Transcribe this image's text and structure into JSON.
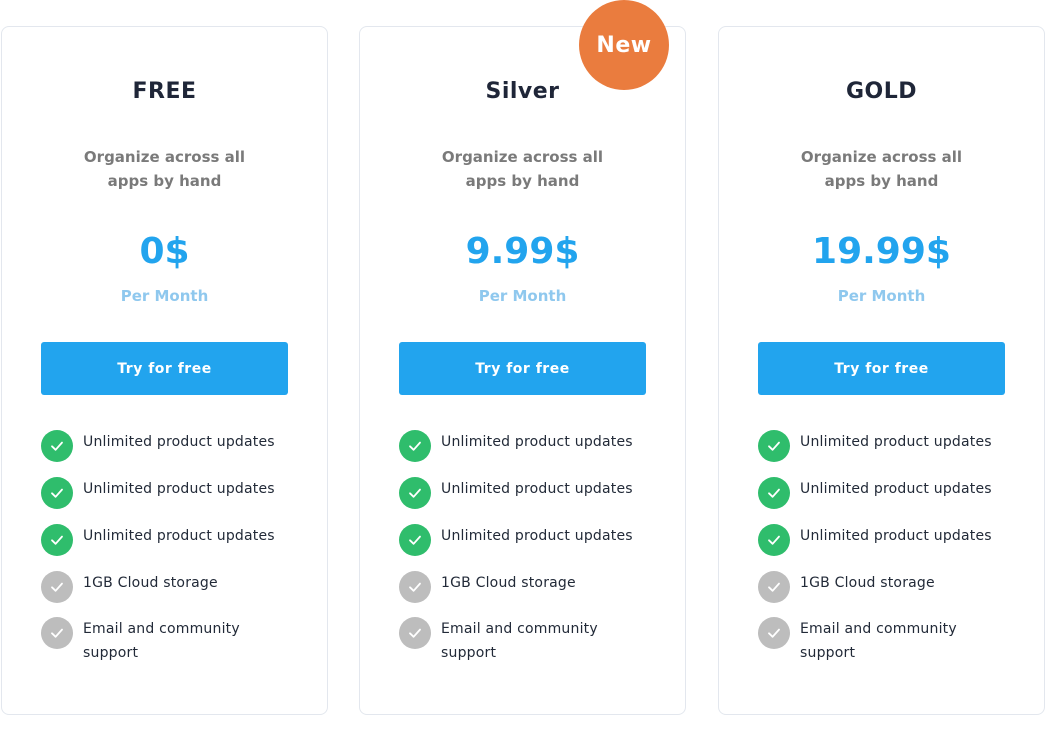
{
  "badge": {
    "label": "New",
    "color": "#ea7c3e"
  },
  "colors": {
    "accent": "#22a4ee",
    "check_on": "#2fbd6c",
    "check_off": "#bdbdbd"
  },
  "plans": [
    {
      "name": "FREE",
      "description": "Organize across all apps by hand",
      "price": "0$",
      "period": "Per Month",
      "cta": "Try for free",
      "features": [
        {
          "text": "Unlimited product updates",
          "included": true,
          "icon": "check-icon"
        },
        {
          "text": "Unlimited product updates",
          "included": true,
          "icon": "check-icon"
        },
        {
          "text": "Unlimited product updates",
          "included": true,
          "icon": "check-icon"
        },
        {
          "text": "1GB  Cloud storage",
          "included": false,
          "icon": "check-icon"
        },
        {
          "text": "Email and community support",
          "included": false,
          "icon": "check-icon"
        }
      ]
    },
    {
      "name": "Silver",
      "description": "Organize across all apps by hand",
      "price": "9.99$",
      "period": "Per Month",
      "cta": "Try for free",
      "features": [
        {
          "text": "Unlimited product updates",
          "included": true,
          "icon": "check-icon"
        },
        {
          "text": "Unlimited product updates",
          "included": true,
          "icon": "check-icon"
        },
        {
          "text": "Unlimited product updates",
          "included": true,
          "icon": "check-icon"
        },
        {
          "text": "1GB  Cloud storage",
          "included": false,
          "icon": "check-icon"
        },
        {
          "text": "Email and community support",
          "included": false,
          "icon": "check-icon"
        }
      ]
    },
    {
      "name": "GOLD",
      "description": "Organize across all apps by hand",
      "price": "19.99$",
      "period": "Per Month",
      "cta": "Try for free",
      "features": [
        {
          "text": "Unlimited product updates",
          "included": true,
          "icon": "check-icon"
        },
        {
          "text": "Unlimited product updates",
          "included": true,
          "icon": "check-icon"
        },
        {
          "text": "Unlimited product updates",
          "included": true,
          "icon": "check-icon"
        },
        {
          "text": "1GB  Cloud storage",
          "included": false,
          "icon": "check-icon"
        },
        {
          "text": "Email and community support",
          "included": false,
          "icon": "check-icon"
        }
      ]
    }
  ]
}
